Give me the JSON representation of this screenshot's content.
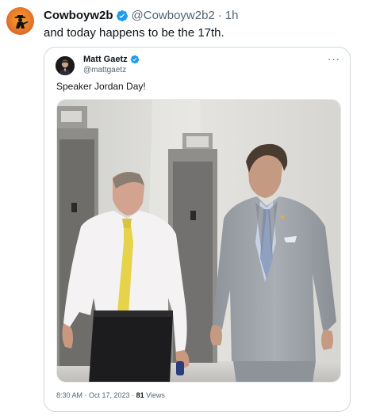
{
  "tweet": {
    "display_name": "Cowboyw2b",
    "handle": "@Cowboyw2b2",
    "separator": "·",
    "time": "1h",
    "text": "and today happens to be the 17th.",
    "avatar_icon": "cowboy-silhouette-icon",
    "verified_icon": "verified-badge-icon",
    "accent_color": "#1d9bf0"
  },
  "quote": {
    "display_name": "Matt Gaetz",
    "handle": "@mattgaetz",
    "more_label": "···",
    "text": "Speaker Jordan Day!",
    "photo_icon": "photo-two-men-walking-hallway",
    "time": "8:30 AM · Oct 17, 2023 · ",
    "views_count": "81",
    "views_label": " Views"
  }
}
